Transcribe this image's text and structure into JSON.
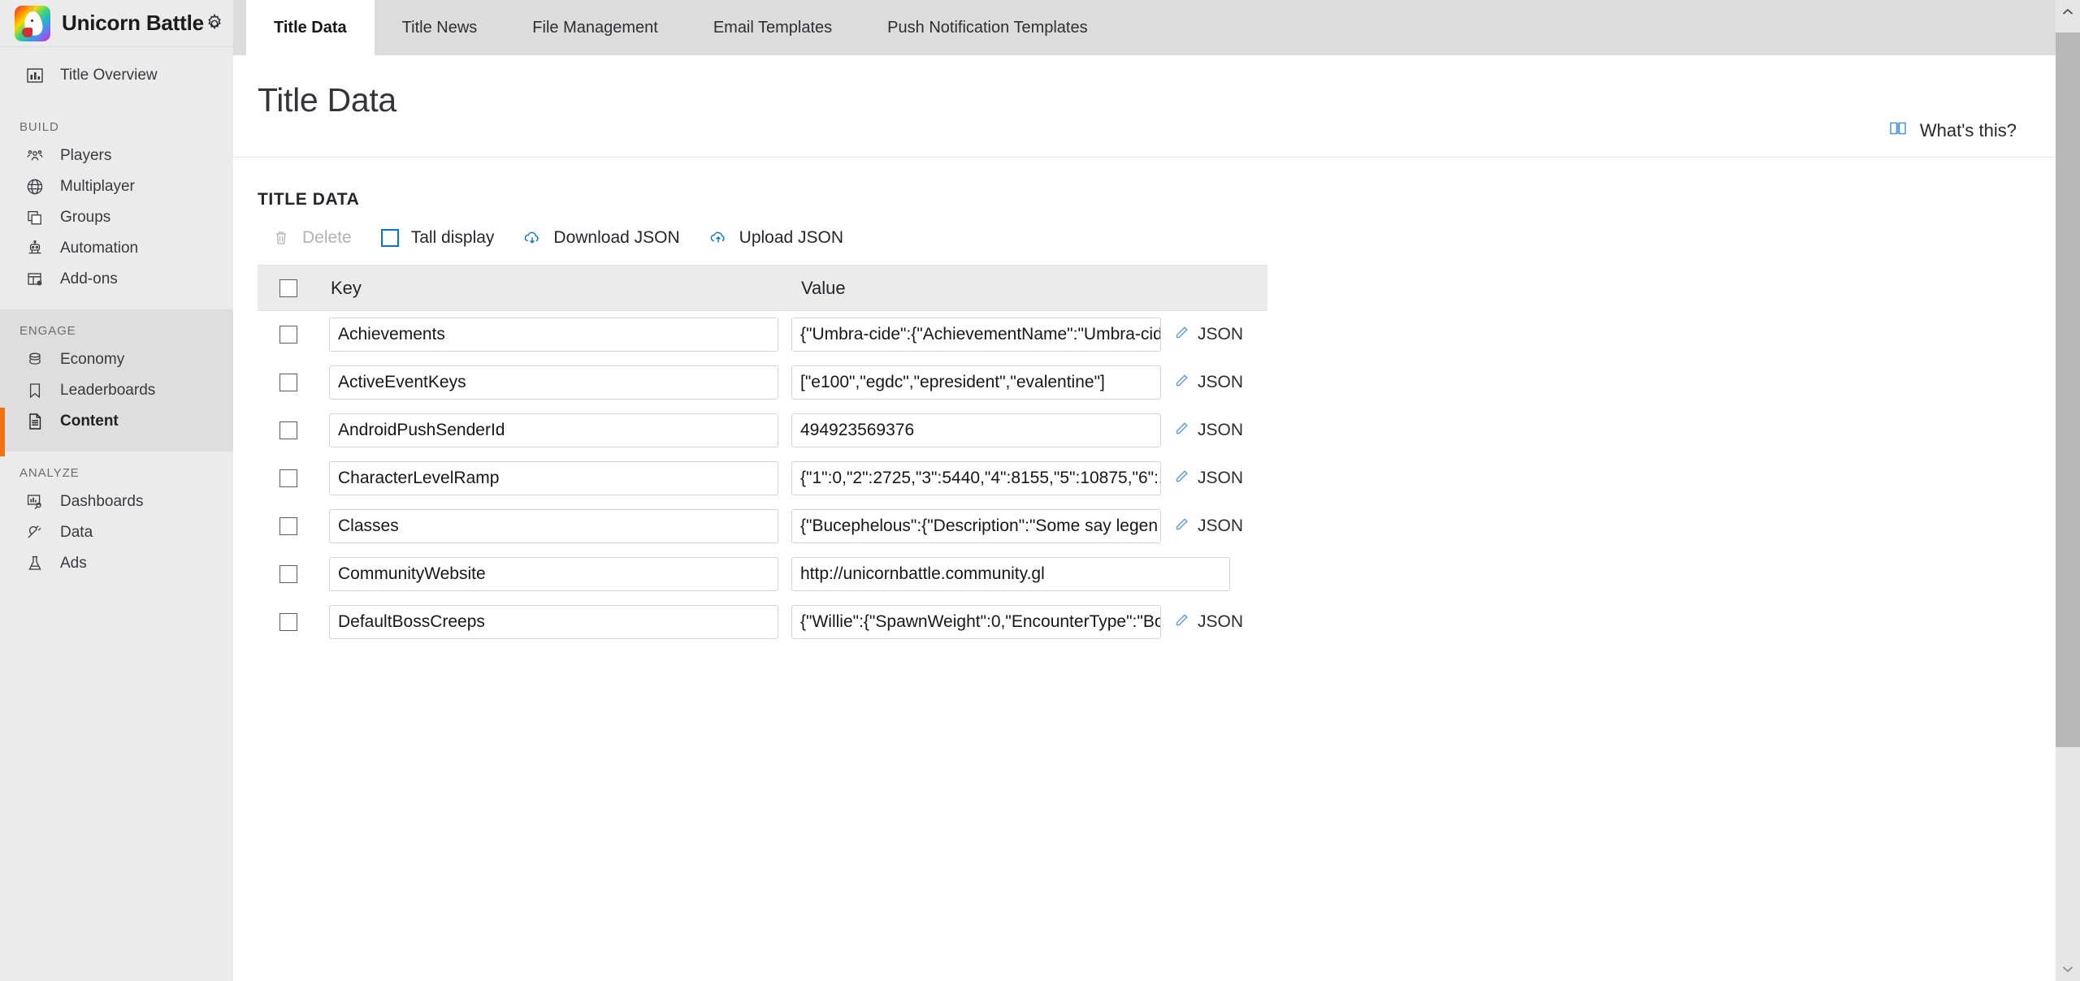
{
  "brand": {
    "title": "Unicorn Battle",
    "logo_icon": "unicorn-logo",
    "settings_icon": "gear-icon"
  },
  "sidebar": {
    "top_item": {
      "label": "Title Overview",
      "icon": "bar-chart-icon"
    },
    "groups": [
      {
        "label": "BUILD",
        "shaded": false,
        "items": [
          {
            "label": "Players",
            "icon": "people-icon"
          },
          {
            "label": "Multiplayer",
            "icon": "globe-icon"
          },
          {
            "label": "Groups",
            "icon": "stacked-squares-icon"
          },
          {
            "label": "Automation",
            "icon": "robot-icon"
          },
          {
            "label": "Add-ons",
            "icon": "table-gear-icon"
          }
        ]
      },
      {
        "label": "ENGAGE",
        "shaded": true,
        "items": [
          {
            "label": "Economy",
            "icon": "coins-icon"
          },
          {
            "label": "Leaderboards",
            "icon": "bookmark-icon"
          },
          {
            "label": "Content",
            "icon": "document-icon",
            "active": true
          }
        ]
      },
      {
        "label": "ANALYZE",
        "shaded": false,
        "items": [
          {
            "label": "Dashboards",
            "icon": "chart-search-icon"
          },
          {
            "label": "Data",
            "icon": "plug-icon"
          },
          {
            "label": "Ads",
            "icon": "flask-icon"
          }
        ]
      }
    ],
    "active_accent_color": "#f2700f"
  },
  "tabs": [
    {
      "label": "Title Data",
      "active": true
    },
    {
      "label": "Title News",
      "active": false
    },
    {
      "label": "File Management",
      "active": false
    },
    {
      "label": "Email Templates",
      "active": false
    },
    {
      "label": "Push Notification Templates",
      "active": false
    }
  ],
  "page": {
    "title": "Title Data",
    "whats_this": {
      "label": "What's this?",
      "icon": "book-icon",
      "icon_color": "#5b9bd5"
    }
  },
  "section": {
    "title": "TITLE DATA",
    "toolbar": [
      {
        "label": "Delete",
        "icon": "trash-icon",
        "disabled": true
      },
      {
        "label": "Tall display",
        "icon": "checkbox-icon",
        "disabled": false
      },
      {
        "label": "Download JSON",
        "icon": "cloud-download-icon",
        "disabled": false
      },
      {
        "label": "Upload JSON",
        "icon": "cloud-upload-icon",
        "disabled": false
      }
    ],
    "accent_color": "#0b72c4"
  },
  "table": {
    "columns": {
      "key": "Key",
      "value": "Value"
    },
    "json_link_label": "JSON",
    "rows": [
      {
        "key": "Achievements",
        "value": "{\"Umbra-cide\":{\"AchievementName\":\"Umbra-cid",
        "has_json": true
      },
      {
        "key": "ActiveEventKeys",
        "value": "[\"e100\",\"egdc\",\"epresident\",\"evalentine\"]",
        "has_json": true
      },
      {
        "key": "AndroidPushSenderId",
        "value": "494923569376",
        "has_json": true
      },
      {
        "key": "CharacterLevelRamp",
        "value": "{\"1\":0,\"2\":2725,\"3\":5440,\"4\":8155,\"5\":10875,\"6\":1",
        "has_json": true
      },
      {
        "key": "Classes",
        "value": "{\"Bucephelous\":{\"Description\":\"Some say legen",
        "has_json": true
      },
      {
        "key": "CommunityWebsite",
        "value": "http://unicornbattle.community.gl",
        "has_json": false
      },
      {
        "key": "DefaultBossCreeps",
        "value": "{\"Willie\":{\"SpawnWeight\":0,\"EncounterType\":\"Bo",
        "has_json": true
      }
    ]
  },
  "scrollbar": {
    "up_icon": "chevron-up-icon",
    "down_icon": "chevron-down-icon"
  }
}
